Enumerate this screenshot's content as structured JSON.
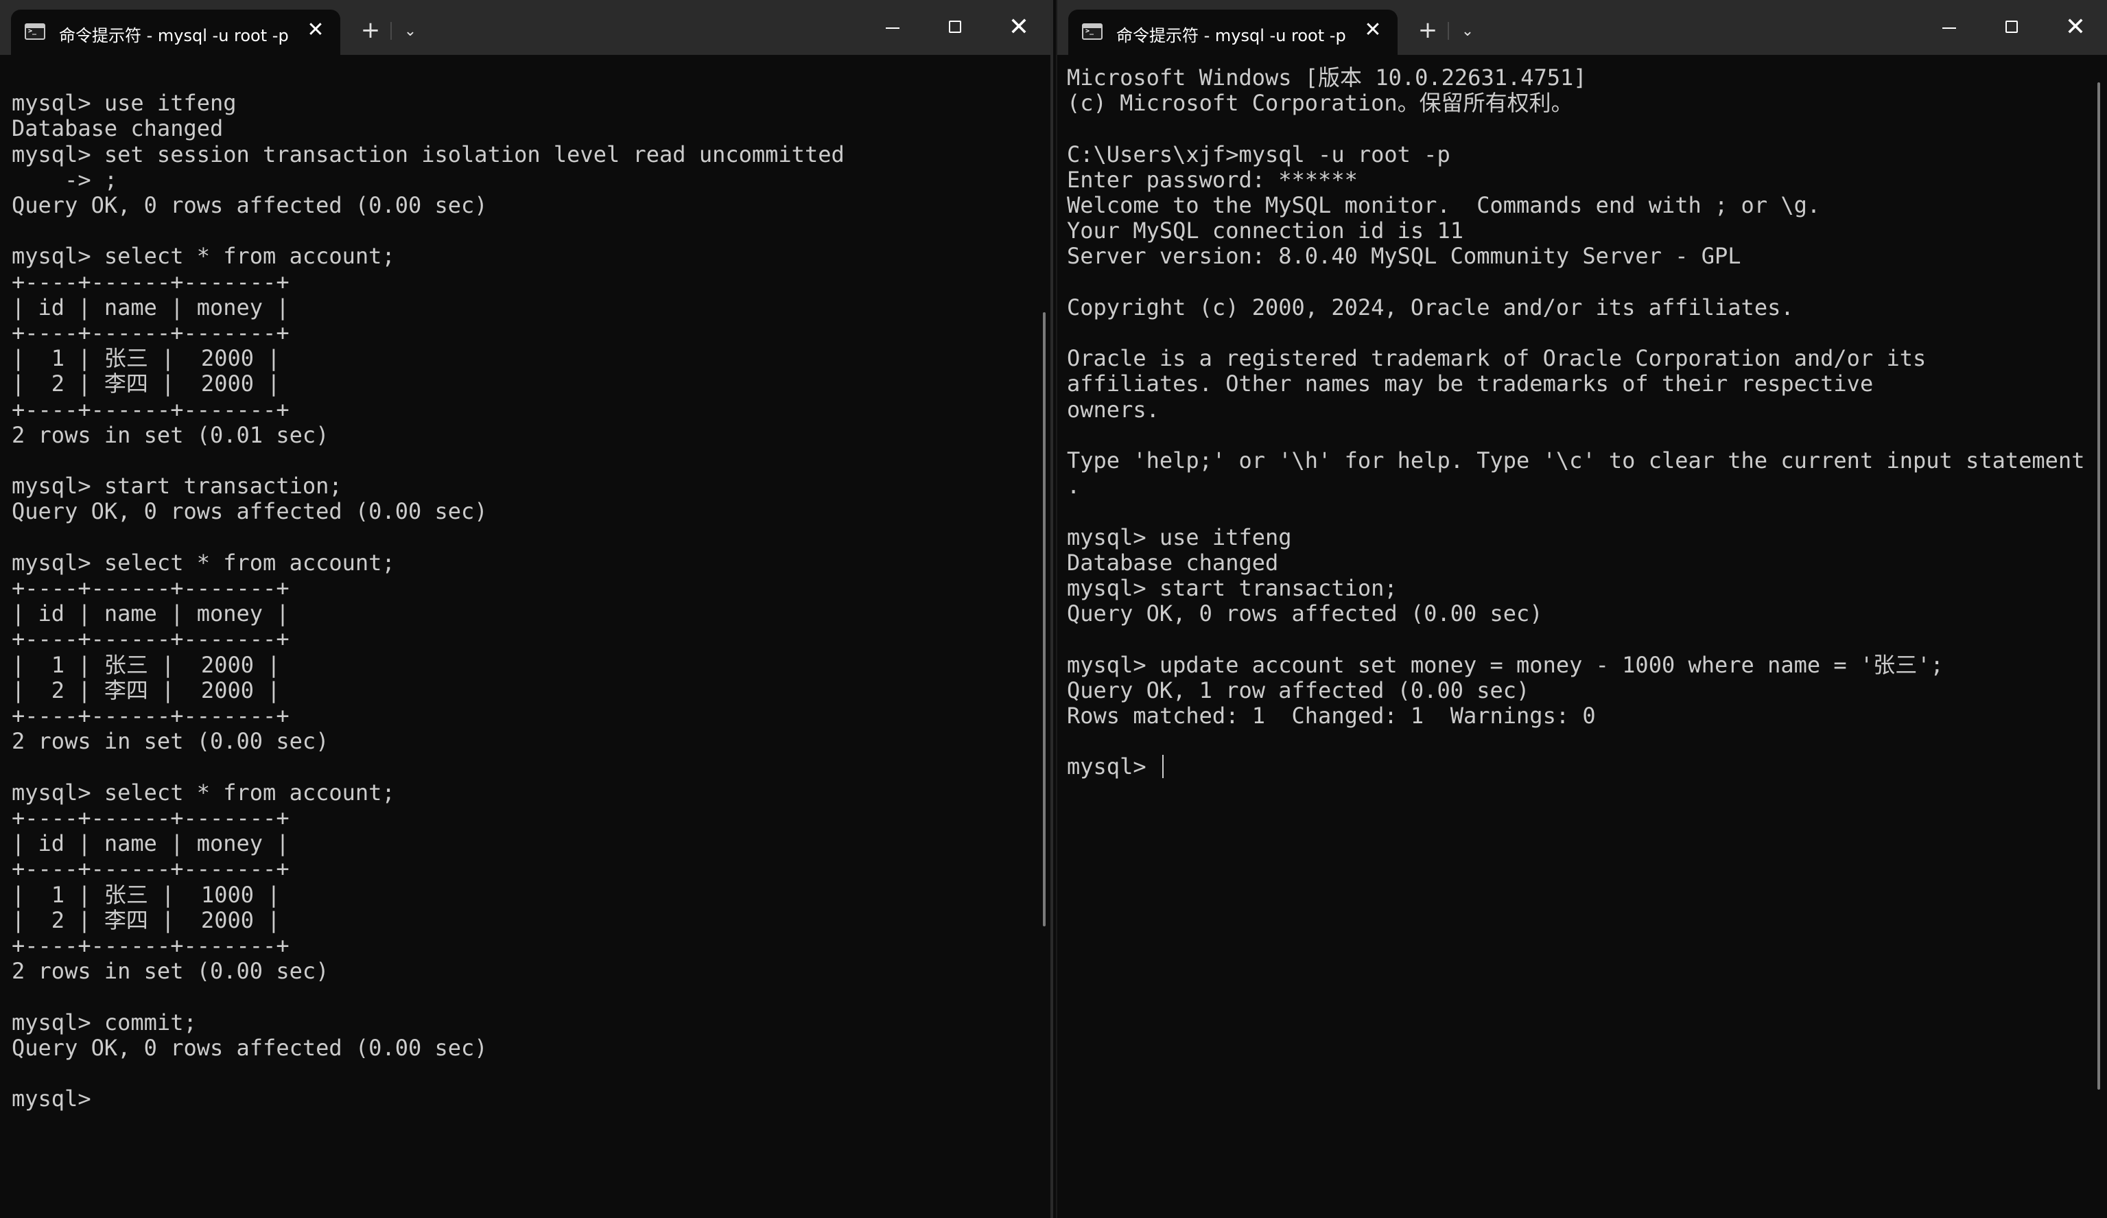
{
  "left_window": {
    "tab_title": "命令提示符 - mysql  -u root -p",
    "lines": [
      "",
      "mysql> use itfeng",
      "Database changed",
      "mysql> set session transaction isolation level read uncommitted",
      "    -> ;",
      "Query OK, 0 rows affected (0.00 sec)",
      "",
      "mysql> select * from account;",
      "+----+------+-------+",
      "| id | name | money |",
      "+----+------+-------+",
      "|  1 | 张三 |  2000 |",
      "|  2 | 李四 |  2000 |",
      "+----+------+-------+",
      "2 rows in set (0.01 sec)",
      "",
      "mysql> start transaction;",
      "Query OK, 0 rows affected (0.00 sec)",
      "",
      "mysql> select * from account;",
      "+----+------+-------+",
      "| id | name | money |",
      "+----+------+-------+",
      "|  1 | 张三 |  2000 |",
      "|  2 | 李四 |  2000 |",
      "+----+------+-------+",
      "2 rows in set (0.00 sec)",
      "",
      "mysql> select * from account;",
      "+----+------+-------+",
      "| id | name | money |",
      "+----+------+-------+",
      "|  1 | 张三 |  1000 |",
      "|  2 | 李四 |  2000 |",
      "+----+------+-------+",
      "2 rows in set (0.00 sec)",
      "",
      "mysql> commit;",
      "Query OK, 0 rows affected (0.00 sec)",
      "",
      "mysql>"
    ]
  },
  "right_window": {
    "tab_title": "命令提示符 - mysql  -u root -p",
    "lines": [
      "Microsoft Windows [版本 10.0.22631.4751]",
      "(c) Microsoft Corporation。保留所有权利。",
      "",
      "C:\\Users\\xjf>mysql -u root -p",
      "Enter password: ******",
      "Welcome to the MySQL monitor.  Commands end with ; or \\g.",
      "Your MySQL connection id is 11",
      "Server version: 8.0.40 MySQL Community Server - GPL",
      "",
      "Copyright (c) 2000, 2024, Oracle and/or its affiliates.",
      "",
      "Oracle is a registered trademark of Oracle Corporation and/or its",
      "affiliates. Other names may be trademarks of their respective",
      "owners.",
      "",
      "Type 'help;' or '\\h' for help. Type '\\c' to clear the current input statement",
      ".",
      "",
      "mysql> use itfeng",
      "Database changed",
      "mysql> start transaction;",
      "Query OK, 0 rows affected (0.00 sec)",
      "",
      "mysql> update account set money = money - 1000 where name = '张三';",
      "Query OK, 1 row affected (0.00 sec)",
      "Rows matched: 1  Changed: 1  Warnings: 0",
      ""
    ],
    "prompt": "mysql> "
  },
  "icons": {
    "new_tab": "+",
    "dropdown": "⌄",
    "close_tab": "✕",
    "close_window": "✕"
  }
}
